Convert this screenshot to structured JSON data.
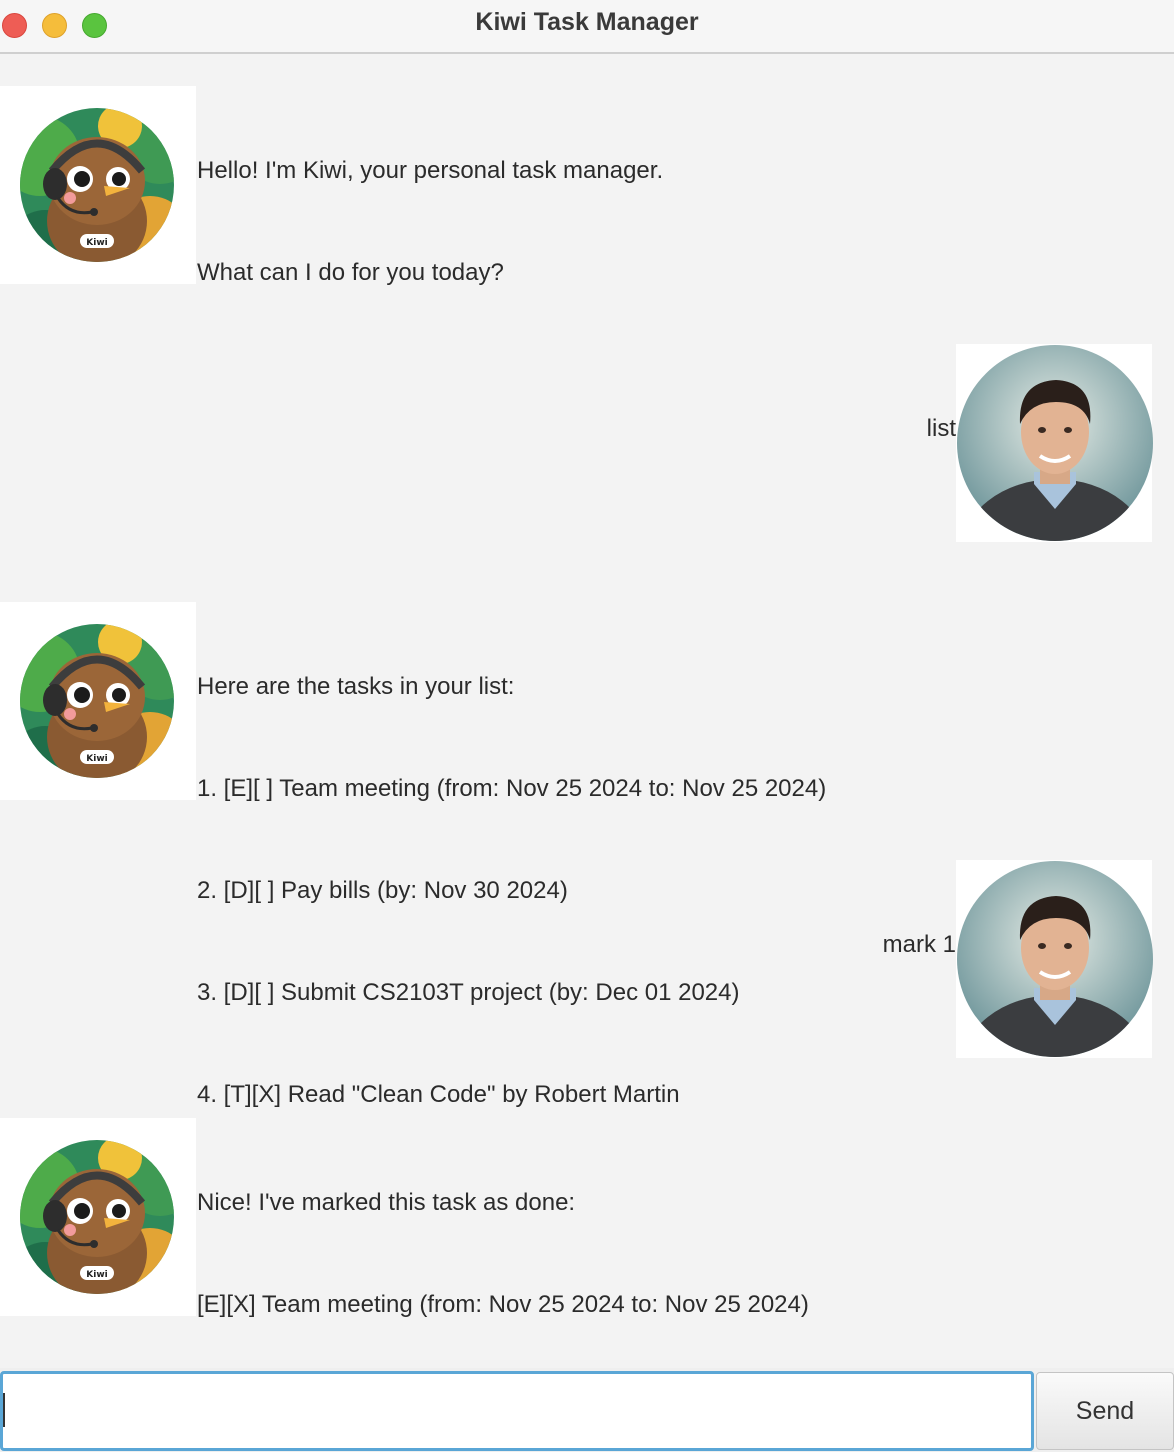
{
  "window": {
    "title": "Kiwi Task Manager"
  },
  "messages": [
    {
      "sender": "bot",
      "avatar_name": "kiwi-bird-avatar",
      "avatar_badge": "Kiwi",
      "lines": [
        "Hello! I'm Kiwi, your personal task manager.",
        "What can I do for you today?"
      ]
    },
    {
      "sender": "user",
      "avatar_name": "user-avatar",
      "lines": [
        "list"
      ]
    },
    {
      "sender": "bot",
      "avatar_name": "kiwi-bird-avatar",
      "avatar_badge": "Kiwi",
      "lines": [
        "Here are the tasks in your list:",
        "1. [E][ ] Team meeting (from: Nov 25 2024 to: Nov 25 2024)",
        "2. [D][ ] Pay bills (by: Nov 30 2024)",
        "3. [D][ ] Submit CS2103T project (by: Dec 01 2024)",
        "4. [T][X] Read \"Clean Code\" by Robert Martin"
      ]
    },
    {
      "sender": "user",
      "avatar_name": "user-avatar",
      "lines": [
        "mark 1"
      ]
    },
    {
      "sender": "bot",
      "avatar_name": "kiwi-bird-avatar",
      "avatar_badge": "Kiwi",
      "lines": [
        "Nice! I've marked this task as done:",
        "[E][X] Team meeting (from: Nov 25 2024 to: Nov 25 2024)"
      ]
    }
  ],
  "input": {
    "value": "",
    "placeholder": ""
  },
  "send_button": {
    "label": "Send"
  },
  "colors": {
    "input_focus_border": "#5aa6d6",
    "close": "#ee5d55",
    "minimize": "#f5bd3b",
    "maximize": "#5ac43f"
  }
}
